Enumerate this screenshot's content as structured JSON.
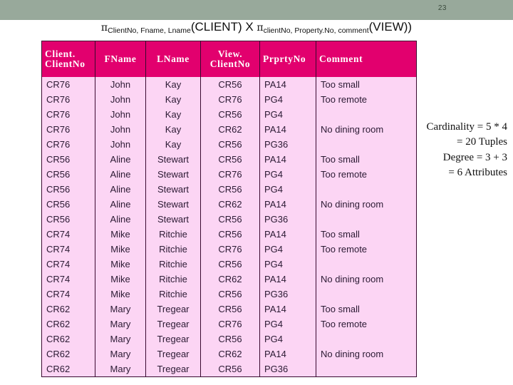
{
  "slide": {
    "number": "23"
  },
  "formula": {
    "pi_symbol": "π",
    "left_subscript": "ClientNo, Fname, Lname",
    "left_relation": "(CLIENT) X ",
    "right_subscript": "clientNo, Property.No, comment",
    "right_relation": "(VIEW))"
  },
  "table": {
    "headers": [
      "Client.\nClientNo",
      "FName",
      "LName",
      "View.\nClientNo",
      "Prprty.No",
      "Comment"
    ],
    "header_lines": {
      "client_no_1": "Client.",
      "client_no_2": "ClientNo",
      "fname": "FName",
      "lname": "LName",
      "view_no_1": "View.",
      "view_no_2": "ClientNo",
      "prprty": "PrprtyNo",
      "comment": "Comment"
    },
    "rows": [
      [
        "CR76",
        "John",
        "Kay",
        "CR56",
        "PA14",
        "Too small"
      ],
      [
        "CR76",
        "John",
        "Kay",
        "CR76",
        "PG4",
        "Too remote"
      ],
      [
        "CR76",
        "John",
        "Kay",
        "CR56",
        "PG4",
        ""
      ],
      [
        "CR76",
        "John",
        "Kay",
        "CR62",
        "PA14",
        "No dining room"
      ],
      [
        "CR76",
        "John",
        "Kay",
        "CR56",
        "PG36",
        ""
      ],
      [
        "CR56",
        "Aline",
        "Stewart",
        "CR56",
        "PA14",
        "Too small"
      ],
      [
        "CR56",
        "Aline",
        "Stewart",
        "CR76",
        "PG4",
        "Too remote"
      ],
      [
        "CR56",
        "Aline",
        "Stewart",
        "CR56",
        "PG4",
        ""
      ],
      [
        "CR56",
        "Aline",
        "Stewart",
        "CR62",
        "PA14",
        "No dining room"
      ],
      [
        "CR56",
        "Aline",
        "Stewart",
        "CR56",
        "PG36",
        ""
      ],
      [
        "CR74",
        "Mike",
        "Ritchie",
        "CR56",
        "PA14",
        "Too small"
      ],
      [
        "CR74",
        "Mike",
        "Ritchie",
        "CR76",
        "PG4",
        "Too remote"
      ],
      [
        "CR74",
        "Mike",
        "Ritchie",
        "CR56",
        "PG4",
        ""
      ],
      [
        "CR74",
        "Mike",
        "Ritchie",
        "CR62",
        "PA14",
        "No dining room"
      ],
      [
        "CR74",
        "Mike",
        "Ritchie",
        "CR56",
        "PG36",
        ""
      ],
      [
        "CR62",
        "Mary",
        "Tregear",
        "CR56",
        "PA14",
        "Too small"
      ],
      [
        "CR62",
        "Mary",
        "Tregear",
        "CR76",
        "PG4",
        "Too remote"
      ],
      [
        "CR62",
        "Mary",
        "Tregear",
        "CR56",
        "PG4",
        ""
      ],
      [
        "CR62",
        "Mary",
        "Tregear",
        "CR62",
        "PA14",
        "No dining room"
      ],
      [
        "CR62",
        "Mary",
        "Tregear",
        "CR56",
        "PG36",
        ""
      ]
    ]
  },
  "annotation": {
    "line1": "Cardinality = 5 * 4",
    "line2": "= 20 Tuples",
    "line3": "Degree = 3 + 3",
    "line4": "= 6 Attributes"
  },
  "colors": {
    "top_bar": "#98a99b",
    "header_fill": "#e2006e",
    "body_fill": "#fcd5f4",
    "border": "#3a0a30",
    "text": "#2b1a33"
  }
}
